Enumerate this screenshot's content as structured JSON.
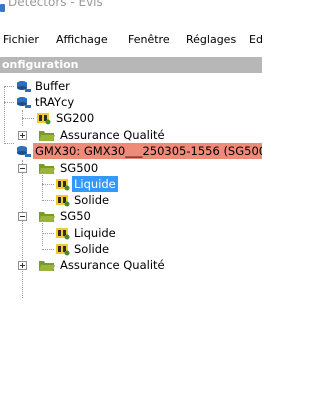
{
  "window": {
    "title": "Detectors - Evis"
  },
  "menu": [
    "Fichier",
    "Affichage",
    "Fenêtre",
    "Réglages",
    "Ed"
  ],
  "panel": {
    "title": "onfiguration"
  },
  "tree": {
    "buffer": "Buffer",
    "traycy": "tRAYcy",
    "sg200": "SG200",
    "assurance_1": "Assurance Qualité",
    "gmx30": "GMX30: GMX30___250305-1556 (SG500",
    "sg500": "SG500",
    "liquide_1": "Liquide",
    "solide_1": "Solide",
    "sg50": "SG50",
    "liquide_2": "Liquide",
    "solide_2": "Solide",
    "assurance_2": "Assurance Qualité"
  },
  "colors": {
    "selection": "#3399ff",
    "highlight": "#f08a78",
    "panel_header": "#b7b7b7",
    "folder_icon": "#9bb53a",
    "sample_icon": "#f2cc2a",
    "database_icon": "#2d6fb8"
  }
}
